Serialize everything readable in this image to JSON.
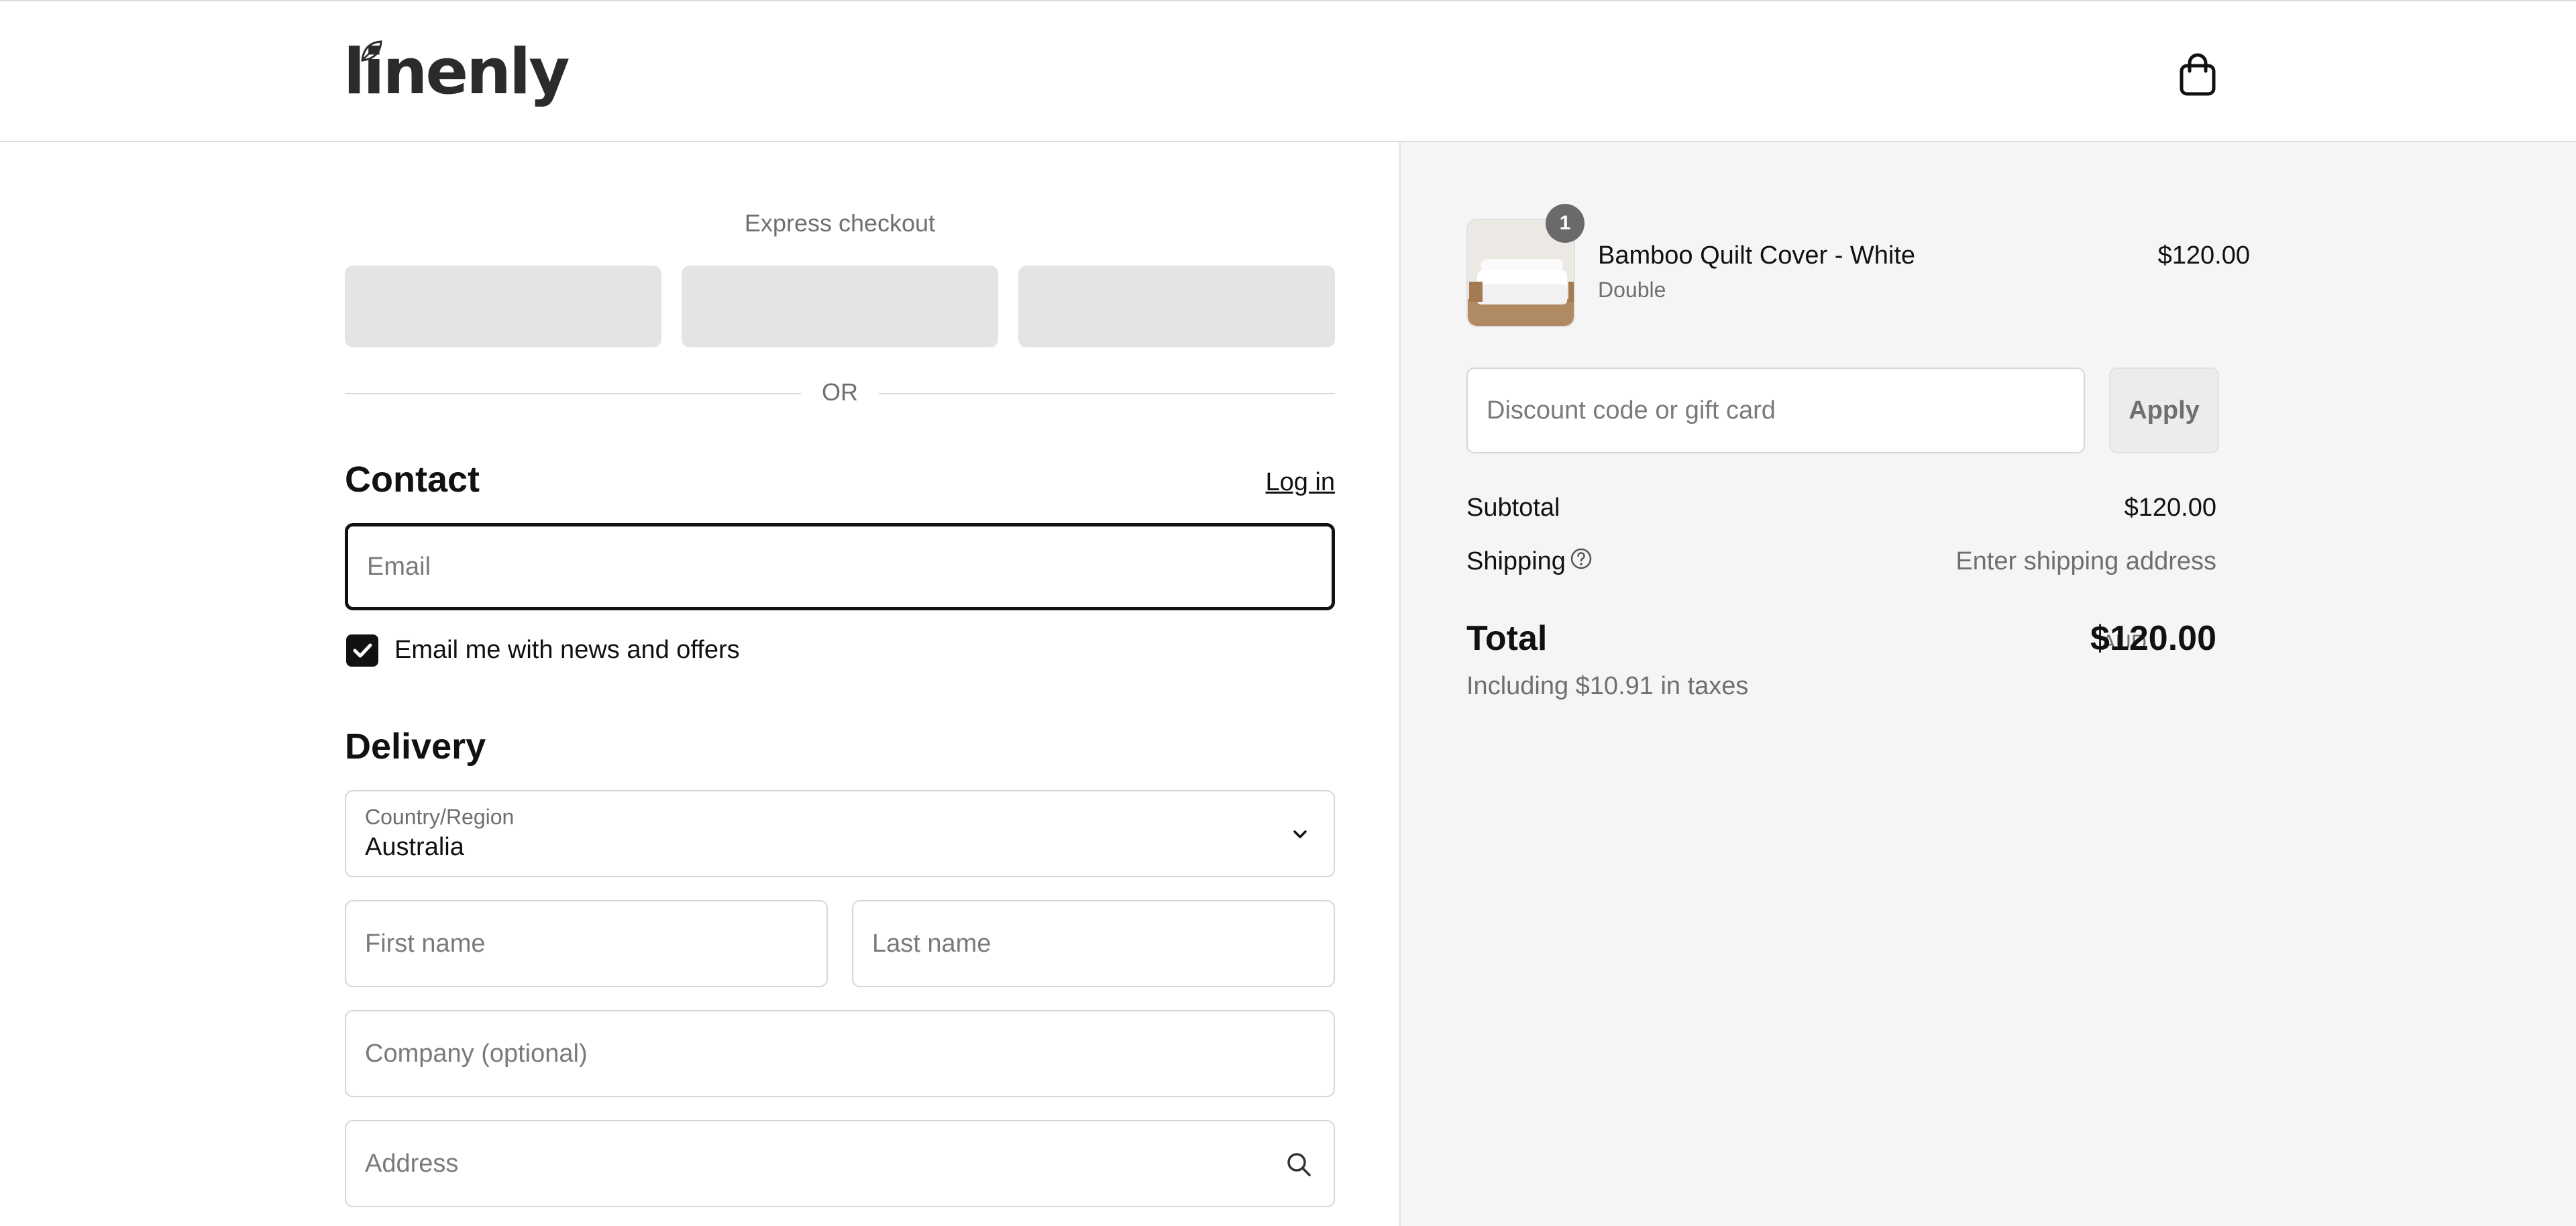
{
  "brand": {
    "logo_text": "linenly"
  },
  "express": {
    "title": "Express checkout",
    "divider": "OR"
  },
  "contact": {
    "title": "Contact",
    "login_link": "Log in",
    "email_placeholder": "Email",
    "newsletter_label": "Email me with news and offers",
    "newsletter_checked": true
  },
  "delivery": {
    "title": "Delivery",
    "country_label": "Country/Region",
    "country_value": "Australia",
    "first_name_placeholder": "First name",
    "last_name_placeholder": "Last name",
    "company_placeholder": "Company (optional)",
    "address_placeholder": "Address"
  },
  "summary": {
    "item": {
      "quantity": "1",
      "name": "Bamboo Quilt Cover - White",
      "variant": "Double",
      "price": "$120.00"
    },
    "discount_placeholder": "Discount code or gift card",
    "apply_label": "Apply",
    "subtotal_label": "Subtotal",
    "subtotal_value": "$120.00",
    "shipping_label": "Shipping",
    "shipping_value": "Enter shipping address",
    "total_label": "Total",
    "currency": "AUD",
    "total_value": "$120.00",
    "tax_note": "Including $10.91 in taxes"
  },
  "colors": {
    "primary": "#111111",
    "muted_text": "#707070",
    "summary_bg": "#f5f5f5",
    "express_button": "#e4e4e4"
  }
}
